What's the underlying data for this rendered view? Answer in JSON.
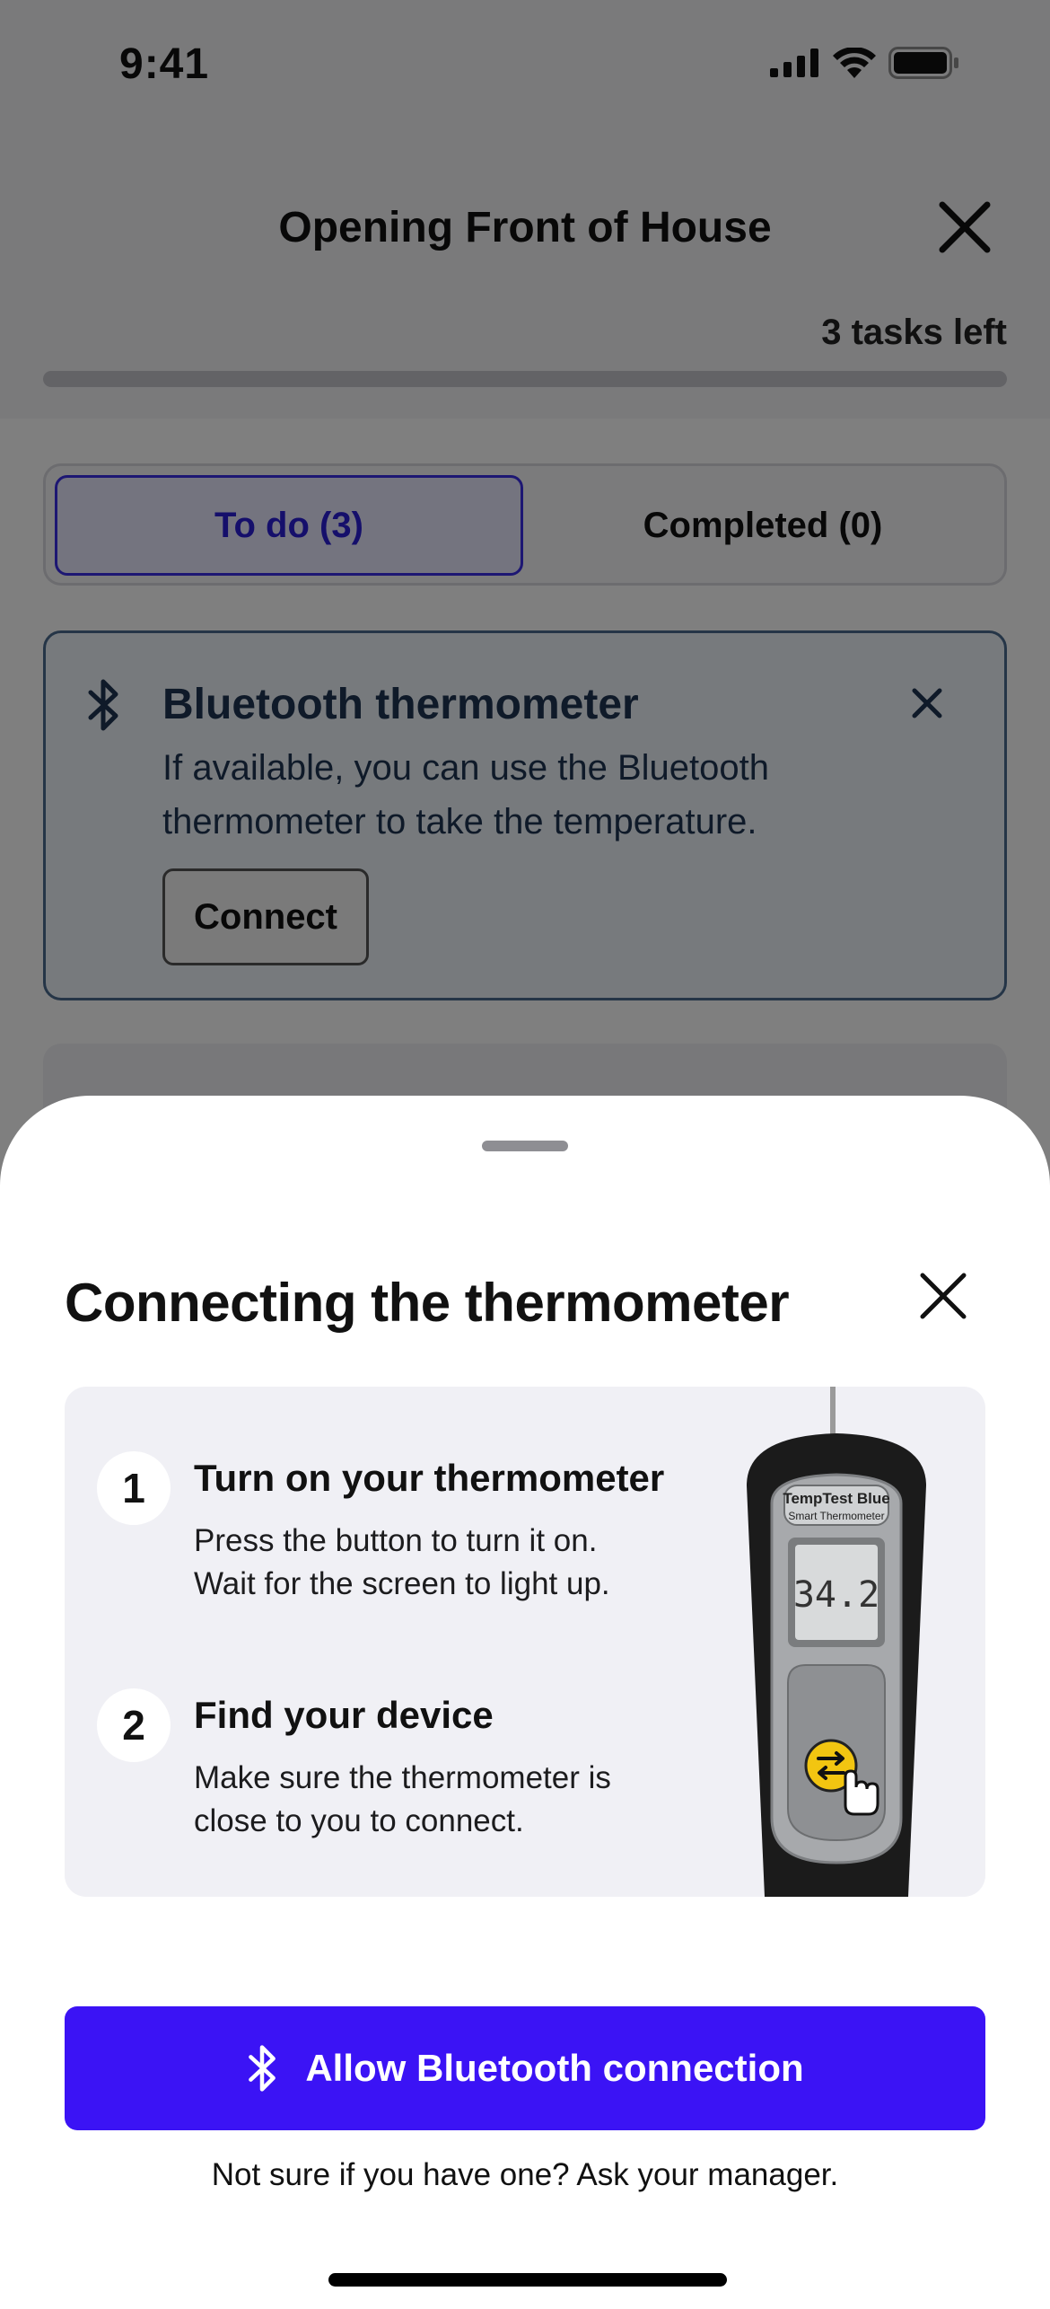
{
  "status_bar": {
    "time": "9:41",
    "icons": [
      "signal-icon",
      "wifi-icon",
      "battery-icon"
    ]
  },
  "nav": {
    "title": "Opening Front of House",
    "close_icon": "close-icon",
    "tasks_left": "3 tasks left",
    "progress": 0
  },
  "tabs": [
    {
      "label": "To do (3)",
      "active": true
    },
    {
      "label": "Completed (0)",
      "active": false
    }
  ],
  "bluetooth_card": {
    "icon": "bluetooth-icon",
    "title": "Bluetooth thermometer",
    "text": "If available, you can use the Bluetooth thermometer to take the temperature.",
    "button": "Connect"
  },
  "sheet": {
    "title": "Connecting the thermometer",
    "steps": [
      {
        "number": "1",
        "title": "Turn on your thermometer",
        "line1": "Press the button to turn it on.",
        "line2": "Wait for the screen to light up."
      },
      {
        "number": "2",
        "title": "Find your device",
        "line1": "Make sure the thermometer is",
        "line2": "close to you to connect."
      }
    ],
    "thermometer": {
      "brand": "TempTest Blue",
      "model": "Smart Thermometer",
      "reading": "34.2"
    },
    "allow_button": "Allow Bluetooth connection",
    "helper_text": "Not sure if you have one? Ask your manager."
  },
  "colors": {
    "primary": "#3B13F5",
    "card_border": "#4B6A8F",
    "panel_bg": "#F0F0F5",
    "thermometer_button": "#F2C511"
  }
}
